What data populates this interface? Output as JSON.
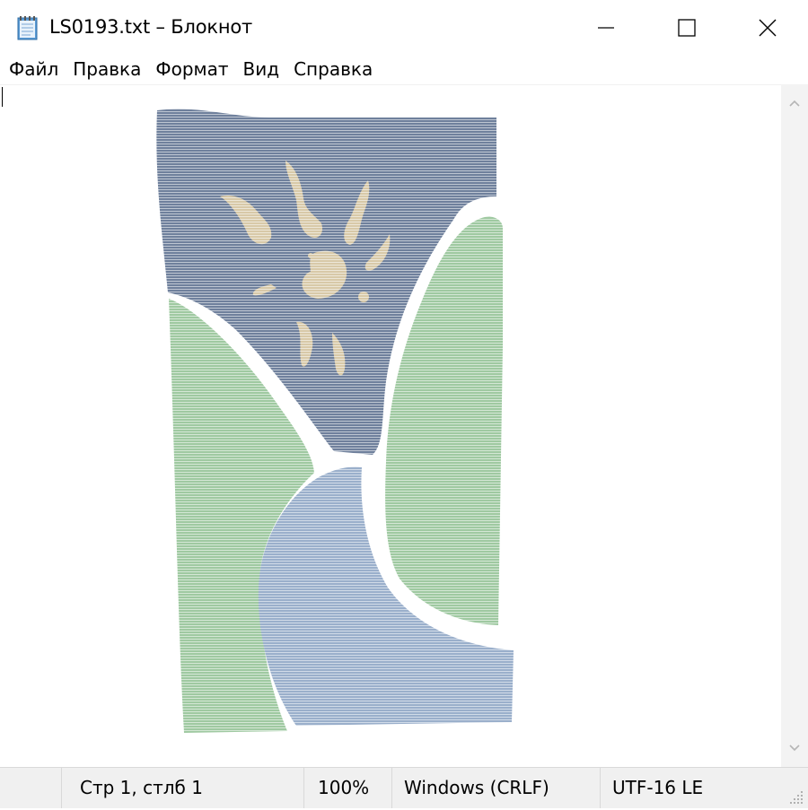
{
  "window": {
    "title": "LS0193.txt – Блокнот"
  },
  "menu": {
    "items": [
      "Файл",
      "Правка",
      "Формат",
      "Вид",
      "Справка"
    ]
  },
  "status": {
    "position": "Стр 1, стлб 1",
    "zoom": "100%",
    "line_ending": "Windows (CRLF)",
    "encoding": "UTF-16 LE"
  },
  "icons": {
    "app": "notepad-icon",
    "minimize": "minimize-icon",
    "maximize": "maximize-icon",
    "close": "close-icon",
    "scroll_up": "chevron-up-icon",
    "scroll_down": "chevron-down-icon",
    "size_grip": "resize-grip-icon"
  },
  "colors": {
    "sky": "#6f809c",
    "sun": "#d8c9a8",
    "green": "#9fc9a1",
    "river": "#9aafcb"
  }
}
